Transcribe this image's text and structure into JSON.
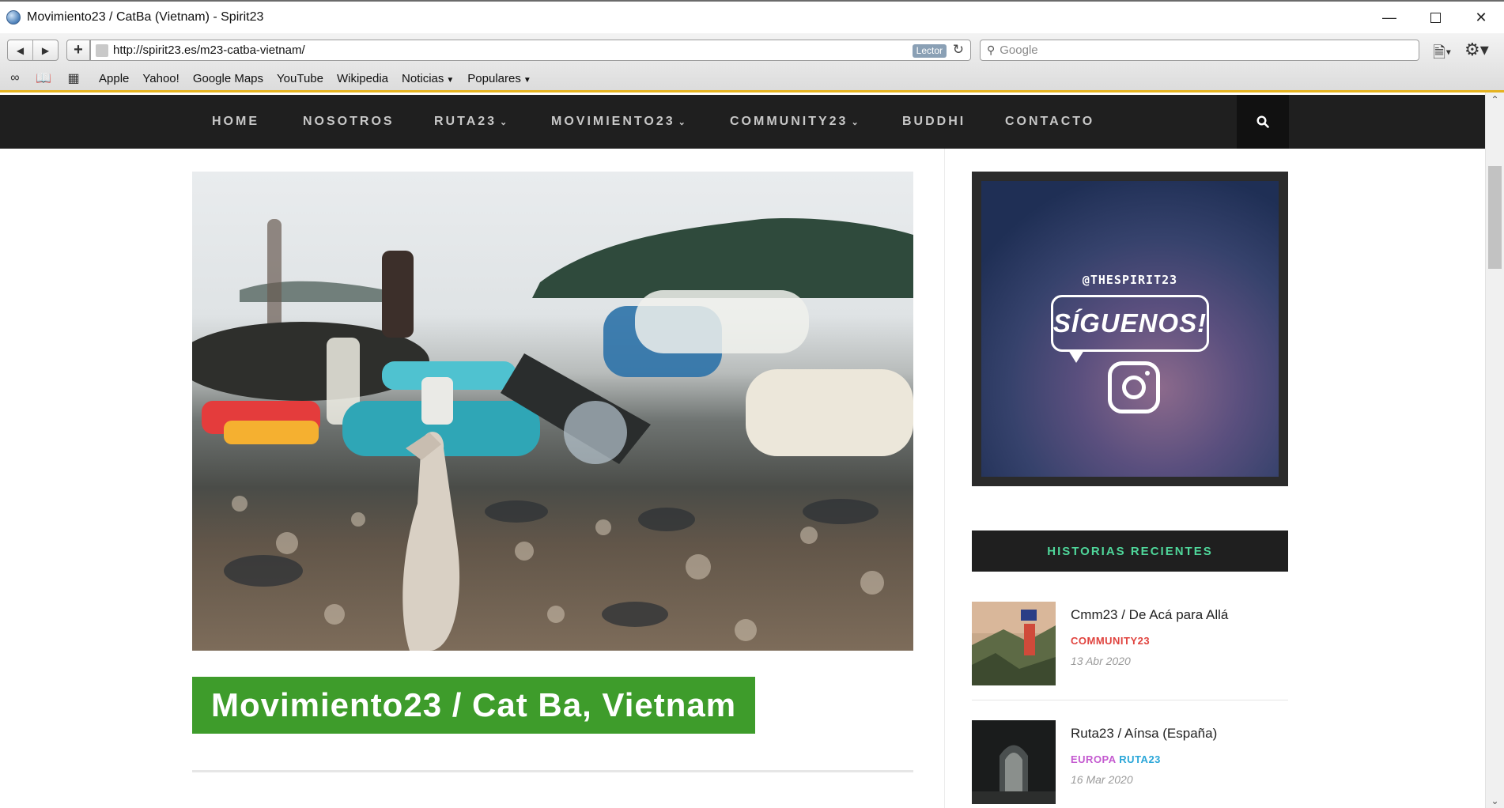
{
  "browser": {
    "window_title": "Movimiento23 / CatBa (Vietnam) - Spirit23",
    "url": "http://spirit23.es/m23-catba-vietnam/",
    "reader_label": "Lector",
    "search_placeholder": "Google",
    "bookmarks": [
      "Apple",
      "Yahoo!",
      "Google Maps",
      "YouTube",
      "Wikipedia",
      "Noticias",
      "Populares"
    ]
  },
  "site_nav": {
    "items": [
      {
        "label": "HOME",
        "has_dropdown": false
      },
      {
        "label": "NOSOTROS",
        "has_dropdown": false
      },
      {
        "label": "RUTA23",
        "has_dropdown": true
      },
      {
        "label": "MOVIMIENTO23",
        "has_dropdown": true
      },
      {
        "label": "COMMUNITY23",
        "has_dropdown": true
      },
      {
        "label": "BUDDHI",
        "has_dropdown": false
      },
      {
        "label": "CONTACTO",
        "has_dropdown": false
      }
    ]
  },
  "post": {
    "title": "Movimiento23 / Cat Ba, Vietnam"
  },
  "sidebar": {
    "instagram": {
      "handle": "@THESPIRIT23",
      "cta": "SÍGUENOS!"
    },
    "recent_heading": "HISTORIAS RECIENTES",
    "stories": [
      {
        "title": "Cmm23 / De Acá para Allá",
        "categories": [
          {
            "label": "COMMUNITY23",
            "color": "#e0433e"
          }
        ],
        "date": "13 Abr 2020"
      },
      {
        "title": "Ruta23 / Aínsa (España)",
        "categories": [
          {
            "label": "EUROPA",
            "color": "#c45ad0"
          },
          {
            "label": "RUTA23",
            "color": "#2aa6d8"
          }
        ],
        "date": "16 Mar 2020"
      }
    ]
  },
  "colors": {
    "nav_bg": "#1f1f1f",
    "title_green": "#3e9c2b",
    "widget_accent": "#4fd69a"
  }
}
